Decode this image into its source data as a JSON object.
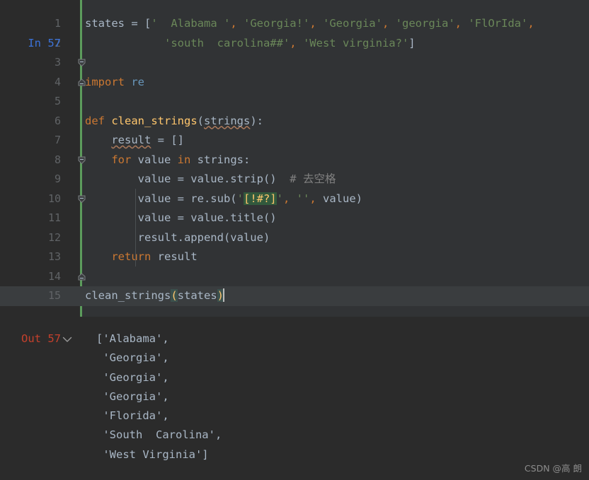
{
  "prompts": {
    "in_label": "In 57",
    "out_label": "Out 57",
    "in_color": "#3b72d8",
    "out_color": "#c4402c",
    "chevron_icon": "chevron-down-icon"
  },
  "editor": {
    "background": "#313335",
    "gutter_background": "#2b2b2b",
    "change_bar_color": "#5c9c5c",
    "current_line_background": "#3a3d3f",
    "current_line_number": 15,
    "lines": [
      {
        "n": 1,
        "fold": "open"
      },
      {
        "n": 2,
        "fold": "end"
      },
      {
        "n": 3,
        "fold": "none"
      },
      {
        "n": 4,
        "fold": "none"
      },
      {
        "n": 5,
        "fold": "none"
      },
      {
        "n": 6,
        "fold": "open"
      },
      {
        "n": 7,
        "fold": "none"
      },
      {
        "n": 8,
        "fold": "open"
      },
      {
        "n": 9,
        "fold": "none"
      },
      {
        "n": 10,
        "fold": "none"
      },
      {
        "n": 11,
        "fold": "none"
      },
      {
        "n": 12,
        "fold": "end"
      },
      {
        "n": 13,
        "fold": "end"
      },
      {
        "n": 14,
        "fold": "none"
      },
      {
        "n": 15,
        "fold": "none"
      }
    ],
    "code": {
      "l1_var": "states",
      "l1_eq": " = [",
      "l1_s1": "'  Alabama '",
      "l1_c1": ",",
      "l1_s2": " 'Georgia!'",
      "l1_c2": ",",
      "l1_s3": " 'Georgia'",
      "l1_c3": ",",
      "l1_s4": " 'georgia'",
      "l1_c4": ",",
      "l1_s5": " 'FlOrIda'",
      "l1_c5": ",",
      "l2_indent": "            ",
      "l2_s1": "'south  carolina##'",
      "l2_c1": ",",
      "l2_s2": " 'West virginia?'",
      "l2_close": "]",
      "l4_kw": "import",
      "l4_mod": " re",
      "l6_kw": "def",
      "l6_name": " clean_strings",
      "l6_open": "(",
      "l6_arg": "strings",
      "l6_close": "):",
      "l7_indent": "    ",
      "l7_var": "result",
      "l7_rest": " = []",
      "l8_indent": "    ",
      "l8_for": "for",
      "l8_mid": " value ",
      "l8_in": "in",
      "l8_rest": " strings:",
      "l9_indent": "        ",
      "l9_code": "value = value.strip()",
      "l9_comment": "  # 去空格",
      "l10_indent": "        ",
      "l10_a": "value = re.sub(",
      "l10_q1": "'",
      "l10_regex": "[!#?]",
      "l10_q2": "'",
      "l10_c1": ",",
      "l10_q3": " ''",
      "l10_c2": ",",
      "l10_b": " value)",
      "l11_indent": "        ",
      "l11_code": "value = value.title()",
      "l12_indent": "        ",
      "l12_code": "result.append(value)",
      "l13_indent": "    ",
      "l13_kw": "return",
      "l13_rest": " result",
      "l15_name": "clean_strings",
      "l15_open": "(",
      "l15_arg": "states",
      "l15_close": ")"
    }
  },
  "output": {
    "background": "#2b2b2b",
    "rows": [
      "['Alabama',",
      " 'Georgia',",
      " 'Georgia',",
      " 'Georgia',",
      " 'Florida',",
      " 'South  Carolina',",
      " 'West Virginia']"
    ]
  },
  "watermark": {
    "text": "CSDN @高 朗"
  }
}
